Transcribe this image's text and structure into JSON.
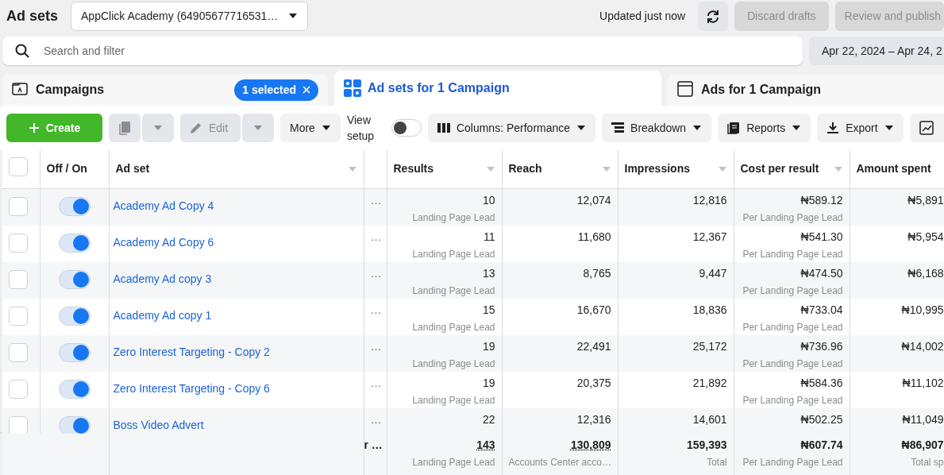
{
  "page_title": "Ad sets",
  "account": {
    "value": "AppClick Academy (64905677716531…"
  },
  "updated": "Updated just now",
  "buttons": [
    {
      "label": "Discard drafts",
      "disabled": true
    },
    {
      "label": "Review and publish",
      "disabled": true
    }
  ],
  "search": {
    "placeholder": "Search and filter"
  },
  "date_range": "Apr 22, 2024 – Apr 24, 2",
  "tabs": [
    {
      "kind": "campaigns",
      "label": "Campaigns",
      "selected": false,
      "badge": "1 selected"
    },
    {
      "kind": "adsets",
      "label": "Ad sets for 1 Campaign",
      "selected": true
    },
    {
      "kind": "ads",
      "label": "Ads for 1 Campaign",
      "selected": false
    }
  ],
  "toolbar": [
    {
      "kind": "create",
      "label": "Create",
      "disabled": false
    },
    {
      "kind": "duplicate",
      "disabled": true
    },
    {
      "kind": "edit",
      "label": "Edit",
      "disabled": true
    },
    {
      "kind": "more",
      "label": "More",
      "disabled": false
    },
    {
      "kind": "view-setup",
      "label": "View setup",
      "on": false
    },
    {
      "kind": "columns",
      "label": "Columns: Performance",
      "disabled": false
    },
    {
      "kind": "breakdown",
      "label": "Breakdown",
      "disabled": false
    },
    {
      "kind": "reports",
      "label": "Reports",
      "disabled": false
    },
    {
      "kind": "export",
      "label": "Export",
      "disabled": false
    },
    {
      "kind": "chart",
      "disabled": false
    }
  ],
  "table": {
    "select_all": {
      "checked": false
    },
    "columns": [
      {
        "label": "Off / On",
        "sortable": false
      },
      {
        "label": "Ad set",
        "sortable": true
      },
      {
        "label": "Results",
        "sortable": true
      },
      {
        "label": "Reach",
        "sortable": true
      },
      {
        "label": "Impressions",
        "sortable": true
      },
      {
        "label": "Cost per result",
        "sortable": true
      },
      {
        "label": "Amount spent",
        "sortable": false
      }
    ],
    "rows": [
      {
        "selected": false,
        "on": true,
        "name": "Academy Ad Copy 4",
        "column_3": "…",
        "results": "10",
        "result_type": "Landing Page Lead",
        "reach": "12,074",
        "impressions": "12,816",
        "cost": "₦589.12",
        "cost_type": "Per Landing Page Lead",
        "spent": "₦5,891"
      },
      {
        "selected": false,
        "on": true,
        "name": "Academy Ad Copy 6",
        "column_3": "…",
        "results": "11",
        "result_type": "Landing Page Lead",
        "reach": "11,680",
        "impressions": "12,367",
        "cost": "₦541.30",
        "cost_type": "Per Landing Page Lead",
        "spent": "₦5,954"
      },
      {
        "selected": false,
        "on": true,
        "name": "Academy Ad copy 3",
        "column_3": "…",
        "results": "13",
        "result_type": "Landing Page Lead",
        "reach": "8,765",
        "impressions": "9,447",
        "cost": "₦474.50",
        "cost_type": "Per Landing Page Lead",
        "spent": "₦6,168"
      },
      {
        "selected": false,
        "on": true,
        "name": "Academy Ad copy 1",
        "column_3": "…",
        "results": "15",
        "result_type": "Landing Page Lead",
        "reach": "16,670",
        "impressions": "18,836",
        "cost": "₦733.04",
        "cost_type": "Per Landing Page Lead",
        "spent": "₦10,995"
      },
      {
        "selected": false,
        "on": true,
        "name": "Zero Interest Targeting - Copy 2",
        "column_3": "…",
        "results": "19",
        "result_type": "Landing Page Lead",
        "reach": "22,491",
        "impressions": "25,172",
        "cost": "₦736.96",
        "cost_type": "Per Landing Page Lead",
        "spent": "₦14,002"
      },
      {
        "selected": false,
        "on": true,
        "name": "Zero Interest Targeting - Copy 6",
        "column_3": "…",
        "results": "19",
        "result_type": "Landing Page Lead",
        "reach": "20,375",
        "impressions": "21,892",
        "cost": "₦584.36",
        "cost_type": "Per Landing Page Lead",
        "spent": "₦11,102"
      },
      {
        "selected": false,
        "on": true,
        "name": "Boss Video Advert",
        "column_3": "…",
        "results": "22",
        "reach": "12,316",
        "impressions": "14,601",
        "cost": "₦502.25",
        "spent": "₦11,049"
      }
    ],
    "totals": {
      "column_3": "r …",
      "results": "143",
      "result_type": "Landing Page Lead",
      "reach": "130,809",
      "reach_note": "Accounts Center acco…",
      "impressions": "159,393",
      "impressions_note": "Total",
      "cost": "₦607.74",
      "cost_type": "Per Landing Page Lead",
      "spent": "₦86,907",
      "spent_note": "Total sp"
    }
  }
}
